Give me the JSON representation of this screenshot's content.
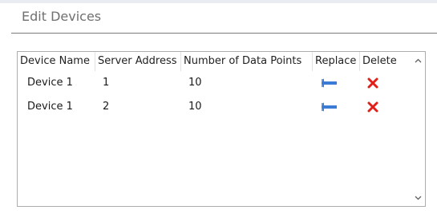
{
  "dialog": {
    "title": "Edit Devices"
  },
  "grid": {
    "columns": [
      "Device Name",
      "Server Address",
      "Number of Data Points",
      "Replace",
      "Delete"
    ],
    "rows": [
      {
        "device_name": "Device 1",
        "server_address": "1",
        "data_points": "10",
        "replace_icon": "replace-arrow-icon",
        "delete_icon": "delete-x-icon"
      },
      {
        "device_name": "Device 1",
        "server_address": "2",
        "data_points": "10",
        "replace_icon": "replace-arrow-icon",
        "delete_icon": "delete-x-icon"
      }
    ]
  },
  "colors": {
    "replace_icon": "#3a7bd5",
    "delete_icon": "#e0201b",
    "title_text": "#707070",
    "border": "#adadad"
  },
  "scrollbar": {
    "up_icon": "chevron-up-icon",
    "down_icon": "chevron-down-icon"
  }
}
